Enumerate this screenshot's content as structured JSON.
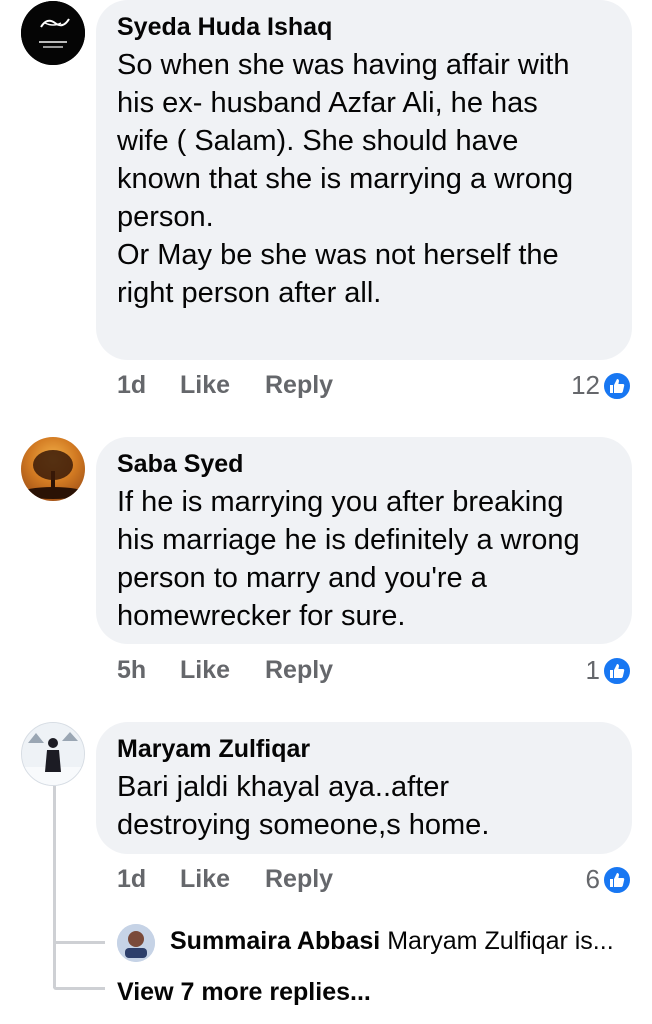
{
  "comments": [
    {
      "name": "Syeda Huda Ishaq",
      "text": "So when she was having affair with\nhis ex- husband Azfar Ali, he has\nwife ( Salam). She should have\nknown that she is marrying a wrong\nperson.\nOr May be she was not herself the\nright person after all.",
      "time": "1d",
      "like": "Like",
      "reply": "Reply",
      "reactions": "12"
    },
    {
      "name": "Saba Syed",
      "text": "If he is marrying you after breaking\nhis marriage he is definitely a wrong\nperson to marry and you're a\nhomewrecker for sure.",
      "time": "5h",
      "like": "Like",
      "reply": "Reply",
      "reactions": "1"
    },
    {
      "name": "Maryam Zulfiqar",
      "text": "Bari jaldi khayal aya..after\ndestroying someone,s home.",
      "time": "1d",
      "like": "Like",
      "reply": "Reply",
      "reactions": "6"
    }
  ],
  "reply_preview": {
    "name": "Summaira Abbasi",
    "text": "Maryam Zulfiqar is..."
  },
  "view_more": "View 7 more replies...",
  "colors": {
    "bubble": "#f0f2f5",
    "secondary_text": "#65676b",
    "like_blue": "#1877f2"
  },
  "icons": [
    "thumbs-up-icon"
  ]
}
